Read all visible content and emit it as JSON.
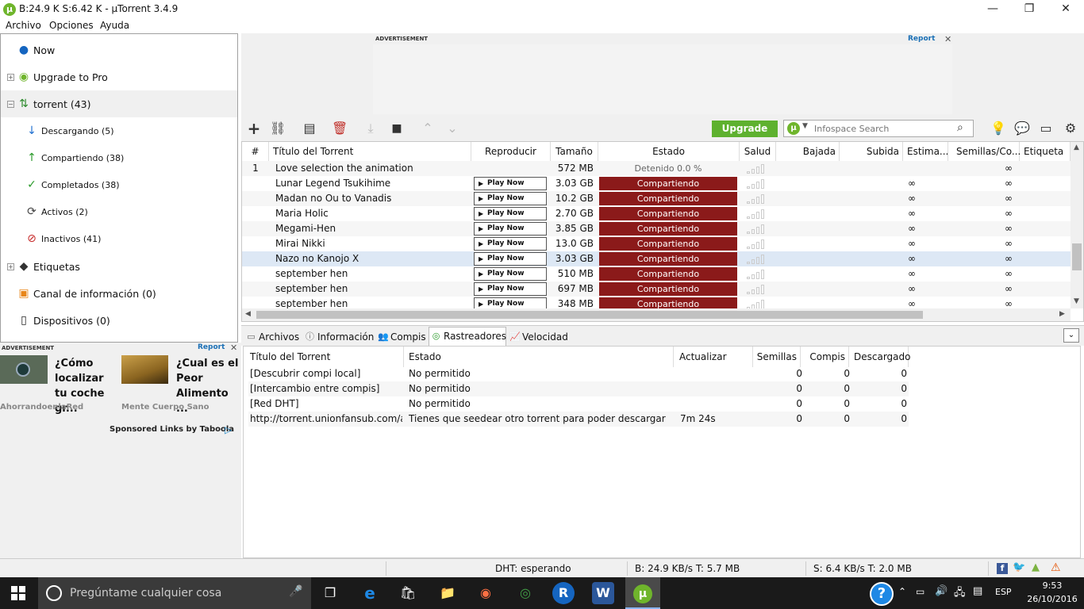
{
  "window": {
    "title": "B:24.9 K S:6.42 K - µTorrent 3.4.9",
    "logo": "µ",
    "minimize": "—",
    "maximize": "❐",
    "close": "✕"
  },
  "menu": [
    "Archivo",
    "Opciones",
    "Ayuda"
  ],
  "sidebar": {
    "items": [
      {
        "label": "Now",
        "icon": "now-icon"
      },
      {
        "label": "Upgrade to Pro",
        "icon": "utorrent-pro-icon"
      },
      {
        "label": "torrent (43)",
        "icon": "torrent-updown-icon"
      },
      {
        "label": "Descargando (5)",
        "icon": "download-arrow-icon"
      },
      {
        "label": "Compartiendo (38)",
        "icon": "upload-arrow-icon"
      },
      {
        "label": "Completados (38)",
        "icon": "checkmark-icon"
      },
      {
        "label": "Activos (2)",
        "icon": "refresh-icon"
      },
      {
        "label": "Inactivos (41)",
        "icon": "inactive-icon"
      },
      {
        "label": "Etiquetas",
        "icon": "tag-icon"
      },
      {
        "label": "Canal de información (0)",
        "icon": "rss-icon"
      },
      {
        "label": "Dispositivos (0)",
        "icon": "device-icon"
      }
    ]
  },
  "ads": {
    "label": "ADVERTISEMENT",
    "report": "Report",
    "close": "✕",
    "left": [
      {
        "headline": "¿Cómo localizar tu coche gr...",
        "source": "AhorrandoenlaRed"
      },
      {
        "headline": "¿Cual es el Peor Alimento ...",
        "source": "Mente Cuerpo Sano"
      }
    ],
    "sponsored": "Sponsored Links by Taboola"
  },
  "toolbar": {
    "upgrade": "Upgrade",
    "search_placeholder": "Infospace Search"
  },
  "torrents": {
    "columns": [
      "#",
      "Título del Torrent",
      "Reproducir",
      "Tamaño",
      "Estado",
      "Salud",
      "Bajada",
      "Subida",
      "Estima...",
      "Semillas/Co...",
      "Etiqueta"
    ],
    "play_label": "Play Now",
    "rows": [
      {
        "num": "1",
        "name": "Love selection the animation",
        "size": "572 MB",
        "status": "Detenido 0.0 %",
        "eta": "",
        "seeds": "∞"
      },
      {
        "num": "",
        "name": "Lunar Legend Tsukihime",
        "size": "3.03 GB",
        "status": "Compartiendo",
        "eta": "∞",
        "seeds": "∞"
      },
      {
        "num": "",
        "name": "Madan no Ou to Vanadis",
        "size": "10.2 GB",
        "status": "Compartiendo",
        "eta": "∞",
        "seeds": "∞"
      },
      {
        "num": "",
        "name": "Maria Holic",
        "size": "2.70 GB",
        "status": "Compartiendo",
        "eta": "∞",
        "seeds": "∞"
      },
      {
        "num": "",
        "name": "Megami-Hen",
        "size": "3.85 GB",
        "status": "Compartiendo",
        "eta": "∞",
        "seeds": "∞"
      },
      {
        "num": "",
        "name": "Mirai Nikki",
        "size": "13.0 GB",
        "status": "Compartiendo",
        "eta": "∞",
        "seeds": "∞"
      },
      {
        "num": "",
        "name": "Nazo no Kanojo X",
        "size": "3.03 GB",
        "status": "Compartiendo",
        "eta": "∞",
        "seeds": "∞"
      },
      {
        "num": "",
        "name": "september hen",
        "size": "510 MB",
        "status": "Compartiendo",
        "eta": "∞",
        "seeds": "∞"
      },
      {
        "num": "",
        "name": "september hen",
        "size": "697 MB",
        "status": "Compartiendo",
        "eta": "∞",
        "seeds": "∞"
      },
      {
        "num": "",
        "name": "september hen",
        "size": "348 MB",
        "status": "Compartiendo",
        "eta": "∞",
        "seeds": "∞"
      }
    ]
  },
  "tabs": [
    "Archivos",
    "Información",
    "Compis",
    "Rastreadores",
    "Velocidad"
  ],
  "trackers": {
    "columns": [
      "Título del Torrent",
      "Estado",
      "Actualizar",
      "Semillas",
      "Compis",
      "Descargado"
    ],
    "rows": [
      {
        "name": "[Descubrir compi local]",
        "status": "No permitido",
        "update": "",
        "seeds": "0",
        "peers": "0",
        "dl": "0"
      },
      {
        "name": "[Intercambio entre compis]",
        "status": "No permitido",
        "update": "",
        "seeds": "0",
        "peers": "0",
        "dl": "0"
      },
      {
        "name": "[Red DHT]",
        "status": "No permitido",
        "update": "",
        "seeds": "0",
        "peers": "0",
        "dl": "0"
      },
      {
        "name": "http://torrent.unionfansub.com/a...",
        "status": "Tienes que seedear otro torrent para poder descargar",
        "update": "7m 24s",
        "seeds": "0",
        "peers": "0",
        "dl": "0"
      }
    ]
  },
  "statusbar": {
    "dht": "DHT: esperando",
    "down": "B: 24.9 KB/s T: 5.7 MB",
    "up": "S: 6.4 KB/s T: 2.0 MB"
  },
  "taskbar": {
    "search": "Pregúntame cualquier cosa",
    "lang": "ESP",
    "time": "9:53",
    "date": "26/10/2016"
  },
  "colors": {
    "seeding": "#8b1a1a",
    "upgrade": "#5eb12f",
    "utorrent": "#6fb52c"
  }
}
